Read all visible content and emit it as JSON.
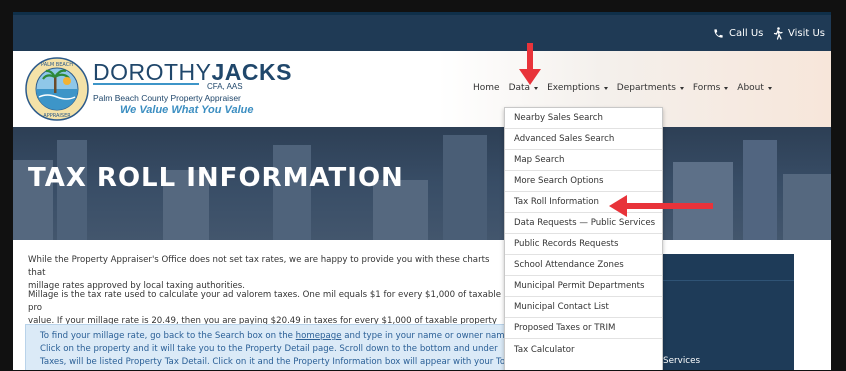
{
  "topbar": {
    "call_label": "Call Us",
    "visit_label": "Visit Us"
  },
  "logo": {
    "first_name": "DOROTHY",
    "last_name": "JACKS",
    "credentials": "CFA, AAS",
    "subtitle": "Palm Beach County Property Appraiser",
    "tagline": "We Value What You Value",
    "seal_text": "PALM BEACH COUNTY PROPERTY APPRAISER"
  },
  "nav": {
    "items": [
      {
        "label": "Home",
        "has_caret": false
      },
      {
        "label": "Data",
        "has_caret": true
      },
      {
        "label": "Exemptions",
        "has_caret": true
      },
      {
        "label": "Departments",
        "has_caret": true
      },
      {
        "label": "Forms",
        "has_caret": true
      },
      {
        "label": "About",
        "has_caret": true
      }
    ]
  },
  "hero": {
    "title": "TAX ROLL INFORMATION"
  },
  "content": {
    "para1_line1": "While the Property Appraiser's Office does not set tax rates, we are happy to provide you with these charts that",
    "para1_line2": "millage rates approved by local taxing authorities.",
    "para2_line1": "Millage is the tax rate used to calculate your ad valorem taxes. One mil equals $1 for every $1,000 of taxable pro",
    "para2_line2": "value. If your millage rate is 20.49, then you are paying $20.49 in taxes for every $1,000 of taxable property valu",
    "info_pre": "To find your millage rate, go back to the Search box on the ",
    "info_link": "homepage",
    "info_post": " and type in your name or owner name",
    "info_line2": "Click on the property and it will take you to the Property Detail page. Scroll down to the bottom and under",
    "info_line3": "Taxes, will be listed Property Tax Detail. Click on it and the Property Information box will appear with your To"
  },
  "sidebar": {
    "text": "Services"
  },
  "dropdown": {
    "items": [
      "Nearby Sales Search",
      "Advanced Sales Search",
      "Map Search",
      "More Search Options",
      "Tax Roll Information",
      "Data Requests — Public Services",
      "Public Records Requests",
      "School Attendance Zones",
      "Municipal Permit Departments",
      "Municipal Contact List",
      "Proposed Taxes or TRIM",
      "Tax Calculator"
    ]
  },
  "colors": {
    "topbar": "#1f3a55",
    "brand_blue": "#20476b",
    "accent_blue": "#3b8ec1",
    "hero_bg": "#384d66",
    "arrow_red": "#e8333a",
    "info_bg": "#dbeaf7"
  },
  "icons": {
    "call": "phone-icon",
    "visit": "walking-person-icon"
  }
}
